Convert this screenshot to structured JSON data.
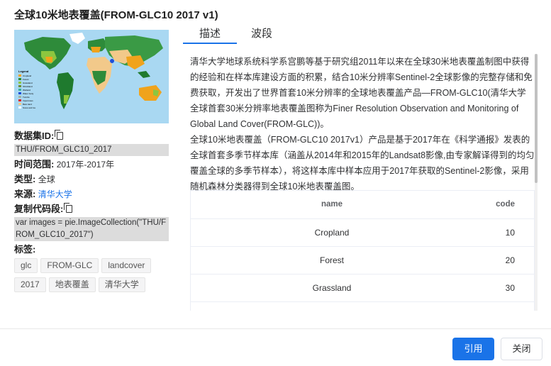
{
  "dialog": {
    "title": "全球10米地表覆盖(FROM-GLC10 2017 v1)"
  },
  "thumbnail": {
    "legend_title": "Legend",
    "legend_items": [
      "Cropland",
      "Forest",
      "Grassland",
      "Shrubland",
      "Wetland",
      "Water body",
      "Tundra",
      "Impervious",
      "Bare land",
      "Snow and Ice"
    ],
    "colors": {
      "ocean": "#a9d8f2",
      "forest": "#2e8b3a",
      "grass": "#8cc63f",
      "crop": "#f0a31c",
      "bare": "#f2c98a",
      "water": "#1f4fd8"
    }
  },
  "meta": {
    "dataset_id_label": "数据集ID:",
    "dataset_id_value": "THU/FROM_GLC10_2017",
    "time_range_label": "时间范围:",
    "time_range_value": "2017年-2017年",
    "type_label": "类型:",
    "type_value": "全球",
    "source_label": "来源:",
    "source_value": "清华大学",
    "code_label": "复制代码段:",
    "code_value": "var images = pie.ImageCollection(\"THU/FROM_GLC10_2017\")",
    "tags_label": "标签:",
    "tags": [
      "glc",
      "FROM-GLC",
      "landcover",
      "2017",
      "地表覆盖",
      "清华大学"
    ]
  },
  "tabs": [
    {
      "label": "描述",
      "active": true
    },
    {
      "label": "波段",
      "active": false
    }
  ],
  "description": {
    "para1": "清华大学地球系统科学系宫鹏等基于研究组2011年以来在全球30米地表覆盖制图中获得的经验和在样本库建设方面的积累，结合10米分辨率Sentinel-2全球影像的完整存储和免费获取，开发出了世界首套10米分辨率的全球地表覆盖产品—FROM-GLC10(清华大学全球首套30米分辨率地表覆盖图称为Finer Resolution Observation and Monitoring of Global Land Cover(FROM-GLC))。",
    "para2": "全球10米地表覆盖（FROM-GLC10 2017v1）产品是基于2017年在《科学通报》发表的全球首套多季节样本库（涵盖从2014年和2015年的Landsat8影像,由专家解译得到的均匀覆盖全球的多季节样本），将这样本库中样本应用于2017年获取的Sentinel-2影像，采用随机森林分类器得到全球10米地表覆盖图。"
  },
  "table": {
    "headers": {
      "name": "name",
      "code": "code"
    },
    "rows": [
      {
        "name": "Cropland",
        "code": "10"
      },
      {
        "name": "Forest",
        "code": "20"
      },
      {
        "name": "Grassland",
        "code": "30"
      }
    ]
  },
  "footer": {
    "cite_label": "引用",
    "close_label": "关闭"
  }
}
